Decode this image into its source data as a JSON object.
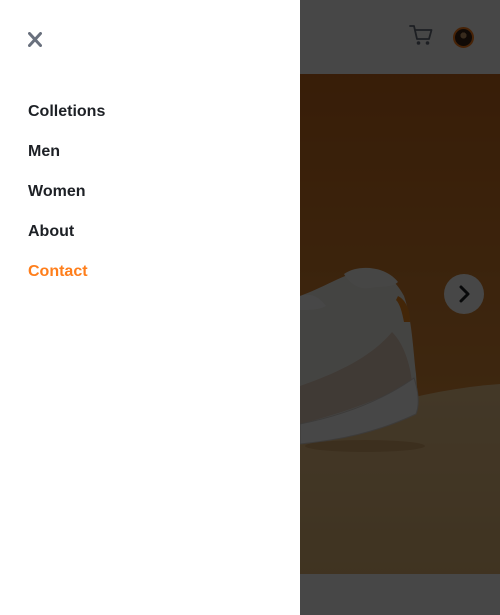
{
  "app": {
    "accent_color": "#ff7e1b",
    "text_color": "#1d2025",
    "overlay_color": "rgba(0,0,0,0.72)"
  },
  "drawer": {
    "close_icon": "close-icon",
    "nav": [
      {
        "label": "Colletions",
        "active": false
      },
      {
        "label": "Men",
        "active": false
      },
      {
        "label": "Women",
        "active": false
      },
      {
        "label": "About",
        "active": false
      },
      {
        "label": "Contact",
        "active": true
      }
    ]
  },
  "header": {
    "cart_icon": "cart-icon",
    "avatar_icon": "avatar"
  },
  "gallery": {
    "background_color": "#d98b2c",
    "next_icon": "chevron-right-icon"
  }
}
